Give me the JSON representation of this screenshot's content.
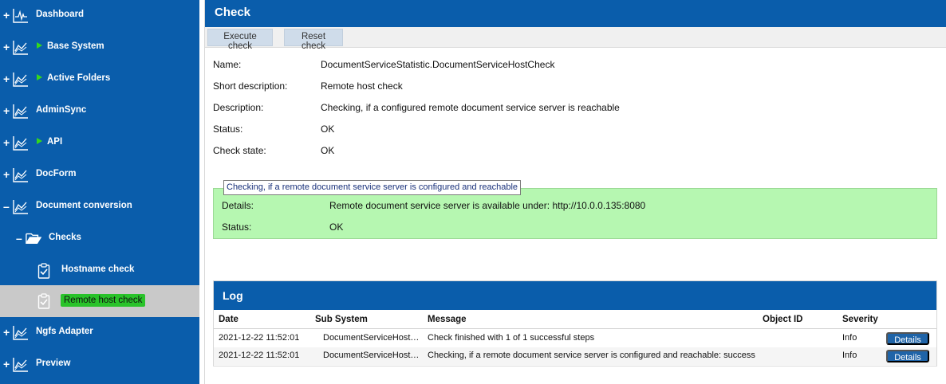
{
  "sidebar": {
    "items": [
      {
        "label": "Dashboard",
        "expander": "+",
        "icon": "heartbeat-icon"
      },
      {
        "label": "Base System",
        "expander": "+",
        "icon": "chart-line-icon"
      },
      {
        "label": "Active Folders",
        "expander": "+",
        "icon": "chart-line-icon"
      },
      {
        "label": "AdminSync",
        "expander": "+",
        "icon": "chart-line-icon"
      },
      {
        "label": "API",
        "expander": "+",
        "icon": "chart-line-icon"
      },
      {
        "label": "DocForm",
        "expander": "+",
        "icon": "chart-line-icon"
      },
      {
        "label": "Document conversion",
        "expander": "–",
        "icon": "chart-line-icon"
      },
      {
        "label": "Checks",
        "expander": "–",
        "icon": "folder-open-icon"
      },
      {
        "label": "Hostname check",
        "icon": "clipboard-check-icon"
      },
      {
        "label": "Remote host check",
        "icon": "clipboard-check-icon"
      },
      {
        "label": "Ngfs Adapter",
        "expander": "+",
        "icon": "chart-line-icon"
      },
      {
        "label": "Preview",
        "expander": "+",
        "icon": "chart-line-icon"
      }
    ]
  },
  "panel": {
    "title": "Check",
    "execute_label": "Execute check",
    "reset_label": "Reset check"
  },
  "info": {
    "name_label": "Name:",
    "name_value": "DocumentServiceStatistic.DocumentServiceHostCheck",
    "short_desc_label": "Short description:",
    "short_desc_value": "Remote host check",
    "desc_label": "Description:",
    "desc_value": "Checking, if a configured remote document service server is reachable",
    "status_label": "Status:",
    "status_value": "OK",
    "check_state_label": "Check state:",
    "check_state_value": "OK"
  },
  "result": {
    "tooltip": "Checking, if a remote document service server is configured and reachable",
    "details_label": "Details:",
    "details_value": "Remote document service server is available under: http://10.0.0.135:8080",
    "status_label": "Status:",
    "status_value": "OK",
    "background_color": "#b6f7b1"
  },
  "log": {
    "title": "Log",
    "columns": [
      "Date",
      "Sub System",
      "Message",
      "Object ID",
      "Severity"
    ],
    "rows": [
      {
        "date": "2021-12-22 11:52:01",
        "sub_system": "DocumentServiceHost…",
        "message": "Check finished with 1 of 1 successful steps",
        "object_id": "",
        "severity": "Info",
        "action": "Details"
      },
      {
        "date": "2021-12-22 11:52:01",
        "sub_system": "DocumentServiceHost…",
        "message": "Checking, if a remote document service server is configured and reachable: success",
        "object_id": "",
        "severity": "Info",
        "action": "Details"
      }
    ]
  },
  "colors": {
    "brand_blue": "#0a5dab",
    "active_green": "#29c32a",
    "arrow_green": "#35d81a"
  }
}
